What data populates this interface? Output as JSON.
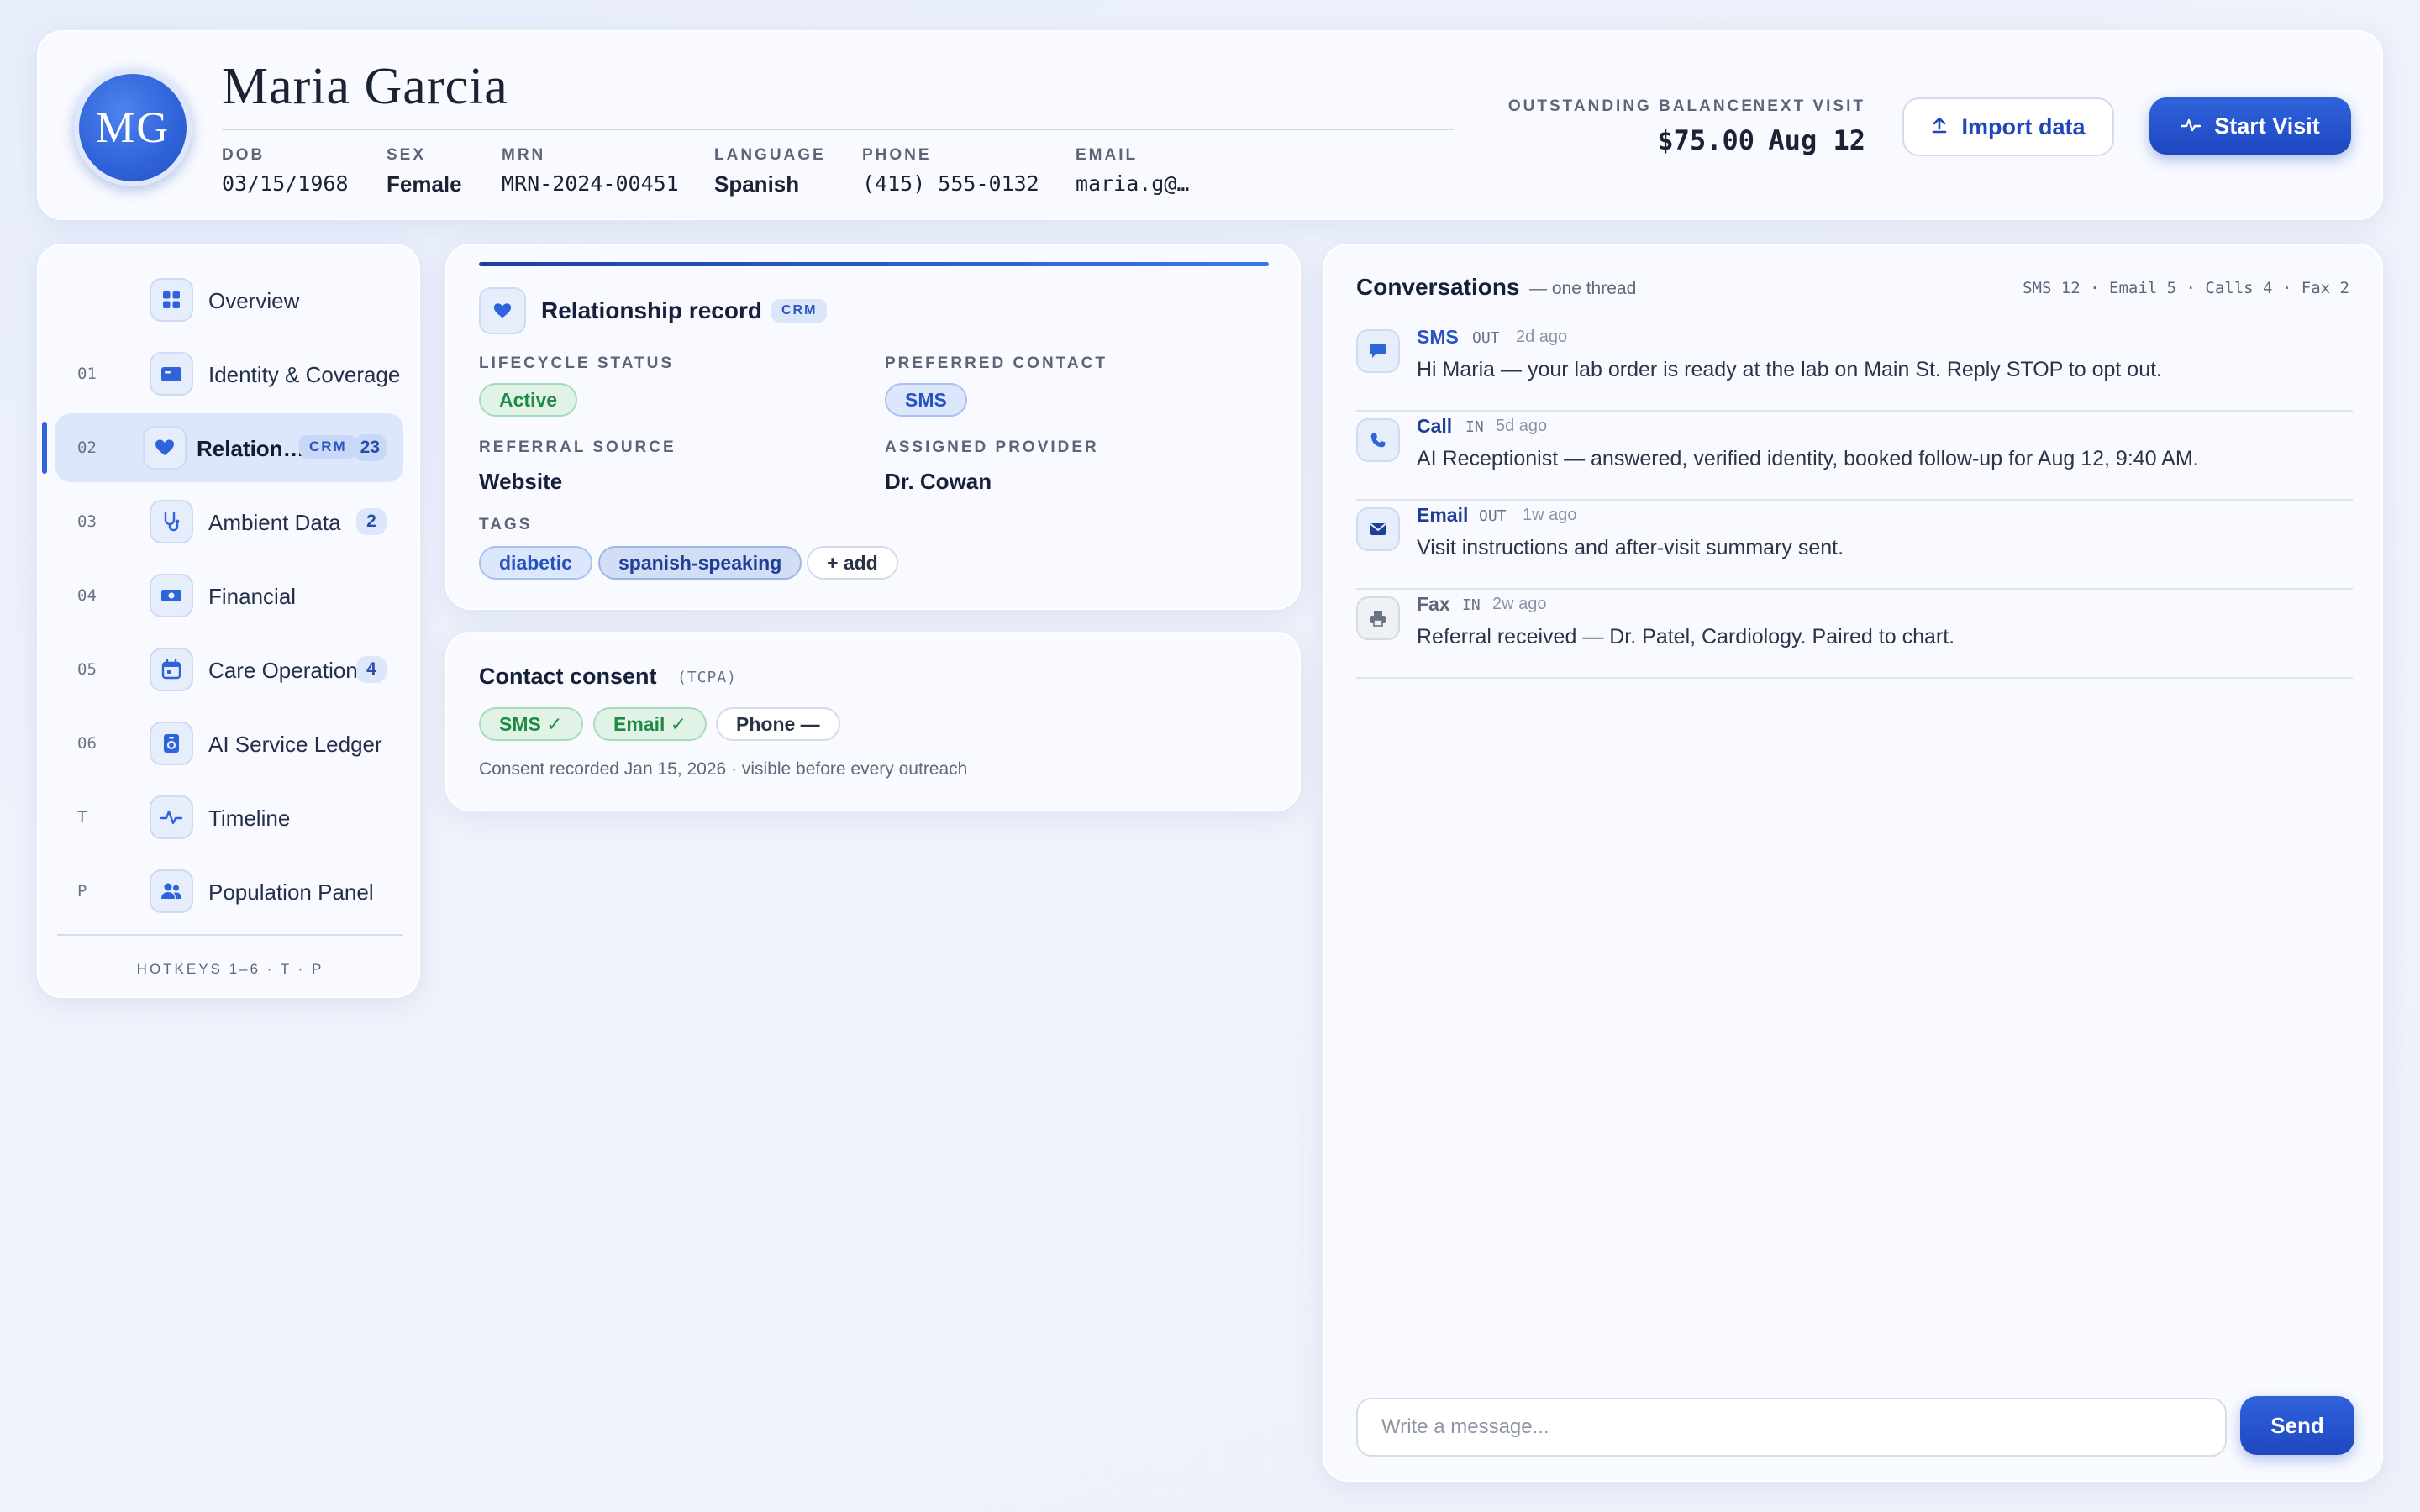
{
  "header": {
    "avatar_initials": "MG",
    "patient_name": "Maria Garcia",
    "demographics": [
      {
        "label": "DOB",
        "value": "03/15/1968"
      },
      {
        "label": "SEX",
        "value": "Female"
      },
      {
        "label": "MRN",
        "value": "MRN-2024-00451"
      },
      {
        "label": "LANGUAGE",
        "value": "Spanish"
      },
      {
        "label": "PHONE",
        "value": "(415) 555-0132"
      },
      {
        "label": "EMAIL",
        "value": "maria.g@…"
      }
    ],
    "outstanding_balance": {
      "label": "OUTSTANDING BALANCE",
      "value": "$75.00"
    },
    "next_visit": {
      "label": "NEXT VISIT",
      "value": "Aug 12"
    },
    "import_label": "Import data",
    "start_visit_label": "Start Visit"
  },
  "sidebar": {
    "items": [
      {
        "num": "",
        "label": "Overview",
        "icon": "grid-icon"
      },
      {
        "num": "01",
        "label": "Identity & Coverage",
        "icon": "id-card-icon"
      },
      {
        "num": "02",
        "label": "Relation…",
        "icon": "heart-icon",
        "badge": "CRM",
        "count": "23",
        "active": true
      },
      {
        "num": "03",
        "label": "Ambient Data",
        "icon": "stethoscope-icon",
        "count": "2"
      },
      {
        "num": "04",
        "label": "Financial",
        "icon": "banknote-icon"
      },
      {
        "num": "05",
        "label": "Care Operations",
        "icon": "calendar-icon",
        "count": "4"
      },
      {
        "num": "06",
        "label": "AI Service Ledger",
        "icon": "ledger-icon"
      },
      {
        "num": "T",
        "label": "Timeline",
        "icon": "pulse-icon"
      },
      {
        "num": "P",
        "label": "Population Panel",
        "icon": "people-icon"
      }
    ],
    "hotkeys": "HOTKEYS 1–6 · T · P"
  },
  "relationship": {
    "title": "Relationship record",
    "badge": "CRM",
    "lifecycle_label": "LIFECYCLE STATUS",
    "lifecycle_value": "Active",
    "preferred_label": "PREFERRED CONTACT",
    "preferred_value": "SMS",
    "referral_label": "REFERRAL SOURCE",
    "referral_value": "Website",
    "provider_label": "ASSIGNED PROVIDER",
    "provider_value": "Dr. Cowan",
    "tags_label": "TAGS",
    "tags": [
      "diabetic",
      "spanish-speaking"
    ],
    "add_tag_label": "+ add"
  },
  "consent": {
    "title": "Contact consent",
    "subtitle": "(TCPA)",
    "chips": [
      "SMS ✓",
      "Email ✓",
      "Phone —"
    ],
    "note": "Consent recorded Jan 15, 2026 · visible before every outreach"
  },
  "conversations": {
    "title": "Conversations",
    "subtitle": "— one thread",
    "stats": "SMS 12 · Email 5 · Calls 4 · Fax 2",
    "messages": [
      {
        "channel": "SMS",
        "direction": "OUT",
        "ago": "2d ago",
        "body": "Hi Maria — your lab order is ready at the lab on Main St. Reply STOP to opt out."
      },
      {
        "channel": "Call",
        "direction": "IN",
        "ago": "5d ago",
        "body": "AI Receptionist — answered, verified identity, booked follow-up for Aug 12, 9:40 AM."
      },
      {
        "channel": "Email",
        "direction": "OUT",
        "ago": "1w ago",
        "body": "Visit instructions and after-visit summary sent."
      },
      {
        "channel": "Fax",
        "direction": "IN",
        "ago": "2w ago",
        "body": "Referral received — Dr. Patel, Cardiology. Paired to chart."
      }
    ],
    "composer_placeholder": "Write a message...",
    "send_label": "Send"
  },
  "colors": {
    "accent": "#2f63dc",
    "accent_dark": "#1f47c0",
    "success": "#1f8a45",
    "background": "#eef2fb"
  }
}
